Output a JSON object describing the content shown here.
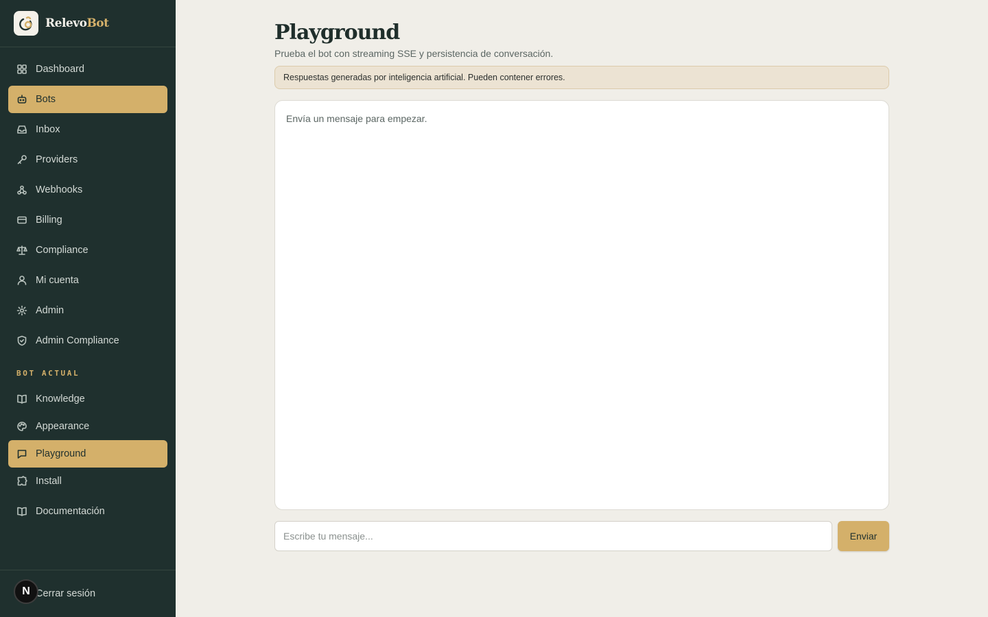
{
  "brand": {
    "name_part1": "Relevo",
    "name_part2": "Bot"
  },
  "nav_main": [
    {
      "label": "Dashboard",
      "icon": "dashboard-icon",
      "active": false
    },
    {
      "label": "Bots",
      "icon": "bot-icon",
      "active": true
    },
    {
      "label": "Inbox",
      "icon": "inbox-icon",
      "active": false
    },
    {
      "label": "Providers",
      "icon": "key-icon",
      "active": false
    },
    {
      "label": "Webhooks",
      "icon": "webhook-icon",
      "active": false
    },
    {
      "label": "Billing",
      "icon": "credit-card-icon",
      "active": false
    },
    {
      "label": "Compliance",
      "icon": "scale-icon",
      "active": false
    },
    {
      "label": "Mi cuenta",
      "icon": "user-icon",
      "active": false
    },
    {
      "label": "Admin",
      "icon": "gear-icon",
      "active": false
    },
    {
      "label": "Admin Compliance",
      "icon": "shield-icon",
      "active": false
    }
  ],
  "section_label": "BOT ACTUAL",
  "nav_bot": [
    {
      "label": "Knowledge",
      "icon": "book-icon",
      "active": false
    },
    {
      "label": "Appearance",
      "icon": "palette-icon",
      "active": false
    },
    {
      "label": "Playground",
      "icon": "chat-icon",
      "active": true
    },
    {
      "label": "Install",
      "icon": "puzzle-icon",
      "active": false
    },
    {
      "label": "Documentación",
      "icon": "book-icon",
      "active": false
    }
  ],
  "footer": {
    "logout_label": "Cerrar sesión",
    "badge": "N"
  },
  "page": {
    "title": "Playground",
    "subtitle": "Prueba el bot con streaming SSE y persistencia de conversación.",
    "notice": "Respuestas generadas por inteligencia artificial. Pueden contener errores.",
    "empty_state": "Envía un mensaje para empezar."
  },
  "composer": {
    "placeholder": "Escribe tu mensaje...",
    "value": "",
    "send_label": "Enviar"
  },
  "colors": {
    "sidebar_bg": "#1f302e",
    "accent": "#d4b06a",
    "page_bg": "#f0eee8"
  }
}
